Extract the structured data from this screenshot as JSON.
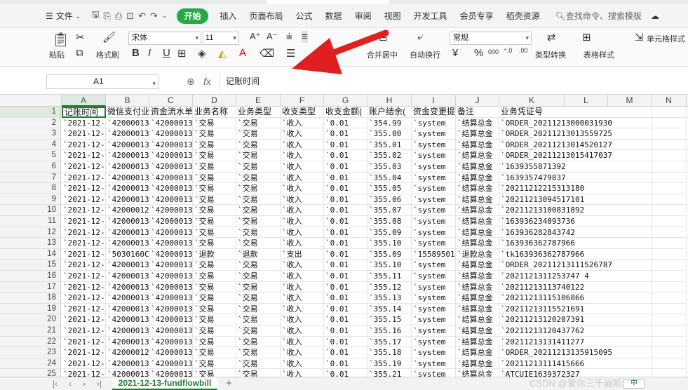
{
  "menu": {
    "file": "文件",
    "start": "开始",
    "items": [
      "插入",
      "页面布局",
      "公式",
      "数据",
      "审阅",
      "视图",
      "开发工具",
      "会员专享",
      "稻壳资源"
    ],
    "search": "查找命令、搜索模板"
  },
  "ribbon": {
    "paste": "粘贴",
    "format_painter": "格式刷",
    "font_name": "宋体",
    "font_size": "11",
    "number_format": "常规",
    "merge_center": "合并居中",
    "wrap_text": "自动换行",
    "type_convert": "类型转换",
    "table_style": "表格样式",
    "cell_style": "单元格样式",
    "bold": "B",
    "italic": "I",
    "underline": "U",
    "percent": "%",
    "yen": "¥"
  },
  "formula_bar": {
    "name_box": "A1",
    "fx": "fx",
    "value": "记账时间"
  },
  "columns": [
    "A",
    "B",
    "C",
    "D",
    "E",
    "F",
    "G",
    "H",
    "I",
    "J",
    "K",
    "L",
    "M",
    "N"
  ],
  "header_row": [
    "记账时间",
    "微信支付业",
    "资金流水单",
    "业务名称",
    "业务类型",
    "收支类型",
    "收支金额(",
    "账户结余(",
    "资金变更提",
    "备注",
    "业务凭证号",
    "",
    ""
  ],
  "rows": [
    [
      "`2021-12-",
      "`42000013",
      "`42000013",
      "`交易",
      "`交易",
      "`收入",
      "`0.01",
      "`354.99",
      "`system",
      "`结算总金",
      "`ORDER_20211213000031930"
    ],
    [
      "`2021-12-",
      "`42000013",
      "`42000013",
      "`交易",
      "`交易",
      "`收入",
      "`0.01",
      "`355.00",
      "`system",
      "`结算总金",
      "`ORDER_20211213013559725"
    ],
    [
      "`2021-12-",
      "`42000013",
      "`42000013",
      "`交易",
      "`交易",
      "`收入",
      "`0.01",
      "`355.01",
      "`system",
      "`结算总金",
      "`ORDER_20211213014520127"
    ],
    [
      "`2021-12-",
      "`42000013",
      "`42000013",
      "`交易",
      "`交易",
      "`收入",
      "`0.01",
      "`355.02",
      "`system",
      "`结算总金",
      "`ORDER_20211213015417037"
    ],
    [
      "`2021-12-",
      "`42000013",
      "`42000013",
      "`交易",
      "`交易",
      "`收入",
      "`0.01",
      "`355.03",
      "`system",
      "`结算总金",
      "`1639355871392"
    ],
    [
      "`2021-12-",
      "`42000013",
      "`42000013",
      "`交易",
      "`交易",
      "`收入",
      "`0.01",
      "`355.04",
      "`system",
      "`结算总金",
      "`1639357479837"
    ],
    [
      "`2021-12-",
      "`42000013",
      "`42000013",
      "`交易",
      "`交易",
      "`收入",
      "`0.01",
      "`355.05",
      "`system",
      "`结算总金",
      "`20211212215313180"
    ],
    [
      "`2021-12-",
      "`42000013",
      "`42000013",
      "`交易",
      "`交易",
      "`收入",
      "`0.01",
      "`355.06",
      "`system",
      "`结算总金",
      "`20211213094517101"
    ],
    [
      "`2021-12-",
      "`42000012",
      "`42000013",
      "`交易",
      "`交易",
      "`收入",
      "`0.01",
      "`355.07",
      "`system",
      "`结算总金",
      "`20211213100831892"
    ],
    [
      "`2021-12-",
      "`42000013",
      "`42000013",
      "`交易",
      "`交易",
      "`收入",
      "`0.01",
      "`355.08",
      "`system",
      "`结算总金",
      "`163936234093736"
    ],
    [
      "`2021-12-",
      "`42000013",
      "`42000013",
      "`交易",
      "`交易",
      "`收入",
      "`0.01",
      "`355.09",
      "`system",
      "`结算总金",
      "`163936282843742"
    ],
    [
      "`2021-12-",
      "`42000013",
      "`42000013",
      "`交易",
      "`交易",
      "`收入",
      "`0.01",
      "`355.10",
      "`system",
      "`结算总金",
      "`163936362787966"
    ],
    [
      "`2021-12-",
      "`5030160C",
      "`42000013",
      "`退款",
      "`退款",
      "`支出",
      "`0.01",
      "`355.09",
      "`15589501",
      "`退款总金",
      "`tk163936362787966"
    ],
    [
      "`2021-12-",
      "`42000013",
      "`42000013",
      "`交易",
      "`交易",
      "`收入",
      "`0.01",
      "`355.10",
      "`system",
      "`结算总金",
      "`ORDER_20211213111526787"
    ],
    [
      "`2021-12-",
      "`42000013",
      "`42000013",
      "`交易",
      "`交易",
      "`收入",
      "`0.01",
      "`355.11",
      "`system",
      "`结算总金",
      "`2021121311253747 4"
    ],
    [
      "`2021-12-",
      "`42000013",
      "`42000013",
      "`交易",
      "`交易",
      "`收入",
      "`0.01",
      "`355.12",
      "`system",
      "`结算总金",
      "`20211213113740122"
    ],
    [
      "`2021-12-",
      "`42000013",
      "`42000013",
      "`交易",
      "`交易",
      "`收入",
      "`0.01",
      "`355.13",
      "`system",
      "`结算总金",
      "`20211213115106866"
    ],
    [
      "`2021-12-",
      "`42000013",
      "`42000013",
      "`交易",
      "`交易",
      "`收入",
      "`0.01",
      "`355.14",
      "`system",
      "`结算总金",
      "`20211213115521691"
    ],
    [
      "`2021-12-",
      "`42000013",
      "`42000013",
      "`交易",
      "`交易",
      "`收入",
      "`0.01",
      "`355.15",
      "`system",
      "`结算总金",
      "`20211213120207391"
    ],
    [
      "`2021-12-",
      "`42000013",
      "`42000013",
      "`交易",
      "`交易",
      "`收入",
      "`0.01",
      "`355.16",
      "`system",
      "`结算总金",
      "`20211213120437762"
    ],
    [
      "`2021-12-",
      "`42000013",
      "`42000013",
      "`交易",
      "`交易",
      "`收入",
      "`0.01",
      "`355.17",
      "`system",
      "`结算总金",
      "`20211213131411277"
    ],
    [
      "`2021-12-",
      "`42000012",
      "`42000013",
      "`交易",
      "`交易",
      "`收入",
      "`0.01",
      "`355.18",
      "`system",
      "`结算总金",
      "`ORDER_20211213135915095"
    ],
    [
      "`2021-12-",
      "`42000013",
      "`42000013",
      "`交易",
      "`交易",
      "`收入",
      "`0.01",
      "`355.19",
      "`system",
      "`结算总金",
      "`20211213111415666"
    ],
    [
      "`2021-12-",
      "`42000013",
      "`42000013",
      "`交易",
      "`交易",
      "`收入",
      "`0.01",
      "`355.21",
      "`system",
      "`结算总金",
      "`ATCUIE1639372327"
    ]
  ],
  "sheet_tab": "2021-12-13-fundflowbill",
  "add_sheet": "+",
  "watermark": "CSDN @爱你三千遍斯塔克",
  "ime": "中",
  "accent_color": "#1e7e34",
  "arrow_color": "#e02020"
}
